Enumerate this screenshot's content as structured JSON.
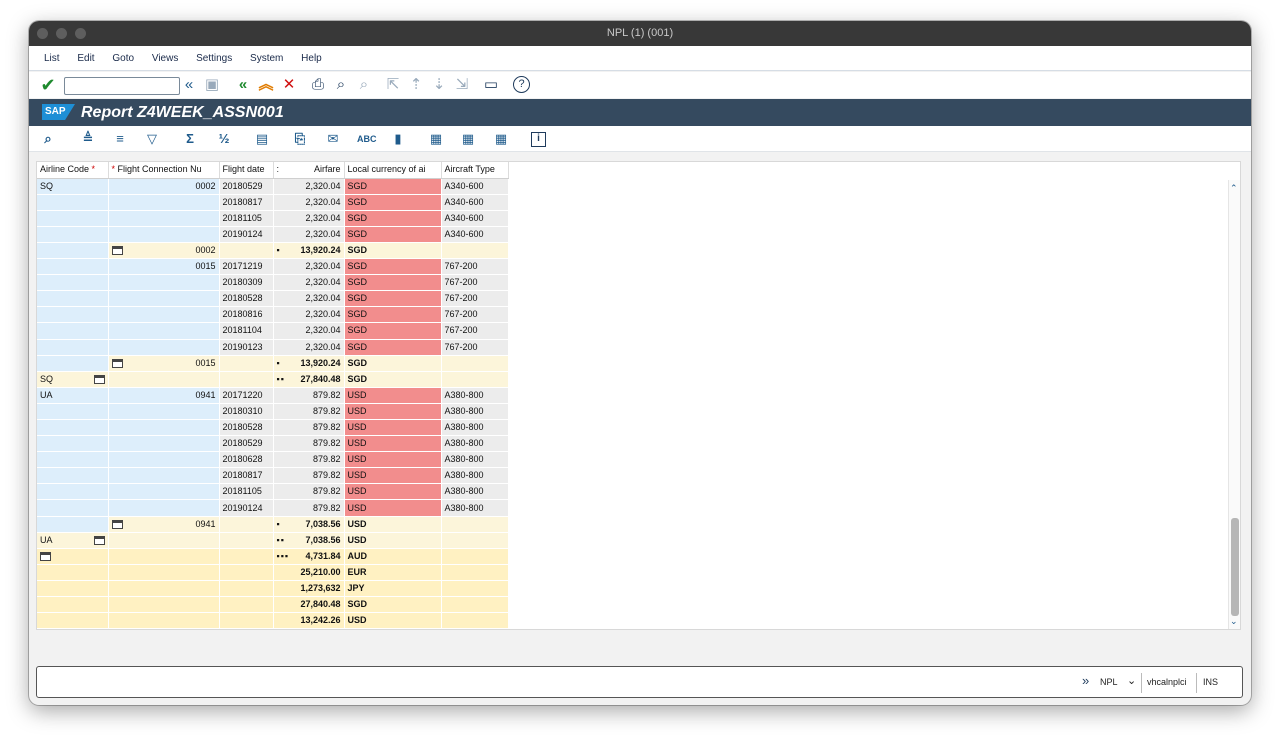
{
  "window": {
    "title": "NPL (1) (001)"
  },
  "menu": [
    "List",
    "Edit",
    "Goto",
    "Views",
    "Settings",
    "System",
    "Help"
  ],
  "header": {
    "title": "Report Z4WEEK_ASSN001",
    "logo": "SAP"
  },
  "columns": [
    "Airline Code",
    "Flight Connection Nu",
    "Flight date",
    "Airfare",
    "Local currency of ai",
    "Aircraft Type"
  ],
  "rows": [
    {
      "t": "d",
      "c1": "SQ",
      "c2": "0002",
      "c3": "20180529",
      "c4": "2,320.04",
      "c5": "SGD",
      "c6": "A340-600"
    },
    {
      "t": "d",
      "c1": "",
      "c2": "",
      "c3": "20180817",
      "c4": "2,320.04",
      "c5": "SGD",
      "c6": "A340-600"
    },
    {
      "t": "d",
      "c1": "",
      "c2": "",
      "c3": "20181105",
      "c4": "2,320.04",
      "c5": "SGD",
      "c6": "A340-600"
    },
    {
      "t": "d",
      "c1": "",
      "c2": "",
      "c3": "20190124",
      "c4": "2,320.04",
      "c5": "SGD",
      "c6": "A340-600"
    },
    {
      "t": "s1",
      "c2": "0002",
      "dots": "▪",
      "c4": "13,920.24",
      "c5": "SGD"
    },
    {
      "t": "d",
      "c1": "",
      "c2": "0015",
      "c3": "20171219",
      "c4": "2,320.04",
      "c5": "SGD",
      "c6": "767-200"
    },
    {
      "t": "d",
      "c1": "",
      "c2": "",
      "c3": "20180309",
      "c4": "2,320.04",
      "c5": "SGD",
      "c6": "767-200"
    },
    {
      "t": "d",
      "c1": "",
      "c2": "",
      "c3": "20180528",
      "c4": "2,320.04",
      "c5": "SGD",
      "c6": "767-200"
    },
    {
      "t": "d",
      "c1": "",
      "c2": "",
      "c3": "20180816",
      "c4": "2,320.04",
      "c5": "SGD",
      "c6": "767-200"
    },
    {
      "t": "d",
      "c1": "",
      "c2": "",
      "c3": "20181104",
      "c4": "2,320.04",
      "c5": "SGD",
      "c6": "767-200"
    },
    {
      "t": "d",
      "c1": "",
      "c2": "",
      "c3": "20190123",
      "c4": "2,320.04",
      "c5": "SGD",
      "c6": "767-200"
    },
    {
      "t": "s1",
      "c2": "0015",
      "dots": "▪",
      "c4": "13,920.24",
      "c5": "SGD"
    },
    {
      "t": "s2",
      "c1": "SQ",
      "dots": "▪▪",
      "c4": "27,840.48",
      "c5": "SGD"
    },
    {
      "t": "d",
      "c1": "UA",
      "c2": "0941",
      "c3": "20171220",
      "c4": "879.82",
      "c5": "USD",
      "c6": "A380-800"
    },
    {
      "t": "d",
      "c1": "",
      "c2": "",
      "c3": "20180310",
      "c4": "879.82",
      "c5": "USD",
      "c6": "A380-800"
    },
    {
      "t": "d",
      "c1": "",
      "c2": "",
      "c3": "20180528",
      "c4": "879.82",
      "c5": "USD",
      "c6": "A380-800"
    },
    {
      "t": "d",
      "c1": "",
      "c2": "",
      "c3": "20180529",
      "c4": "879.82",
      "c5": "USD",
      "c6": "A380-800"
    },
    {
      "t": "d",
      "c1": "",
      "c2": "",
      "c3": "20180628",
      "c4": "879.82",
      "c5": "USD",
      "c6": "A380-800"
    },
    {
      "t": "d",
      "c1": "",
      "c2": "",
      "c3": "20180817",
      "c4": "879.82",
      "c5": "USD",
      "c6": "A380-800"
    },
    {
      "t": "d",
      "c1": "",
      "c2": "",
      "c3": "20181105",
      "c4": "879.82",
      "c5": "USD",
      "c6": "A380-800"
    },
    {
      "t": "d",
      "c1": "",
      "c2": "",
      "c3": "20190124",
      "c4": "879.82",
      "c5": "USD",
      "c6": "A380-800"
    },
    {
      "t": "s1",
      "c2": "0941",
      "dots": "▪",
      "c4": "7,038.56",
      "c5": "USD"
    },
    {
      "t": "s2",
      "c1": "UA",
      "dots": "▪▪",
      "c4": "7,038.56",
      "c5": "USD"
    },
    {
      "t": "g",
      "dots": "▪▪▪",
      "c4": "4,731.84",
      "c5": "AUD",
      "first": true
    },
    {
      "t": "g",
      "dots": "",
      "c4": "25,210.00",
      "c5": "EUR"
    },
    {
      "t": "g",
      "dots": "",
      "c4": "1,273,632",
      "c5": "JPY"
    },
    {
      "t": "g",
      "dots": "",
      "c4": "27,840.48",
      "c5": "SGD"
    },
    {
      "t": "g",
      "dots": "",
      "c4": "13,242.26",
      "c5": "USD"
    }
  ],
  "status": {
    "system": "NPL",
    "host": "vhcalnplci",
    "mode": "INS"
  }
}
